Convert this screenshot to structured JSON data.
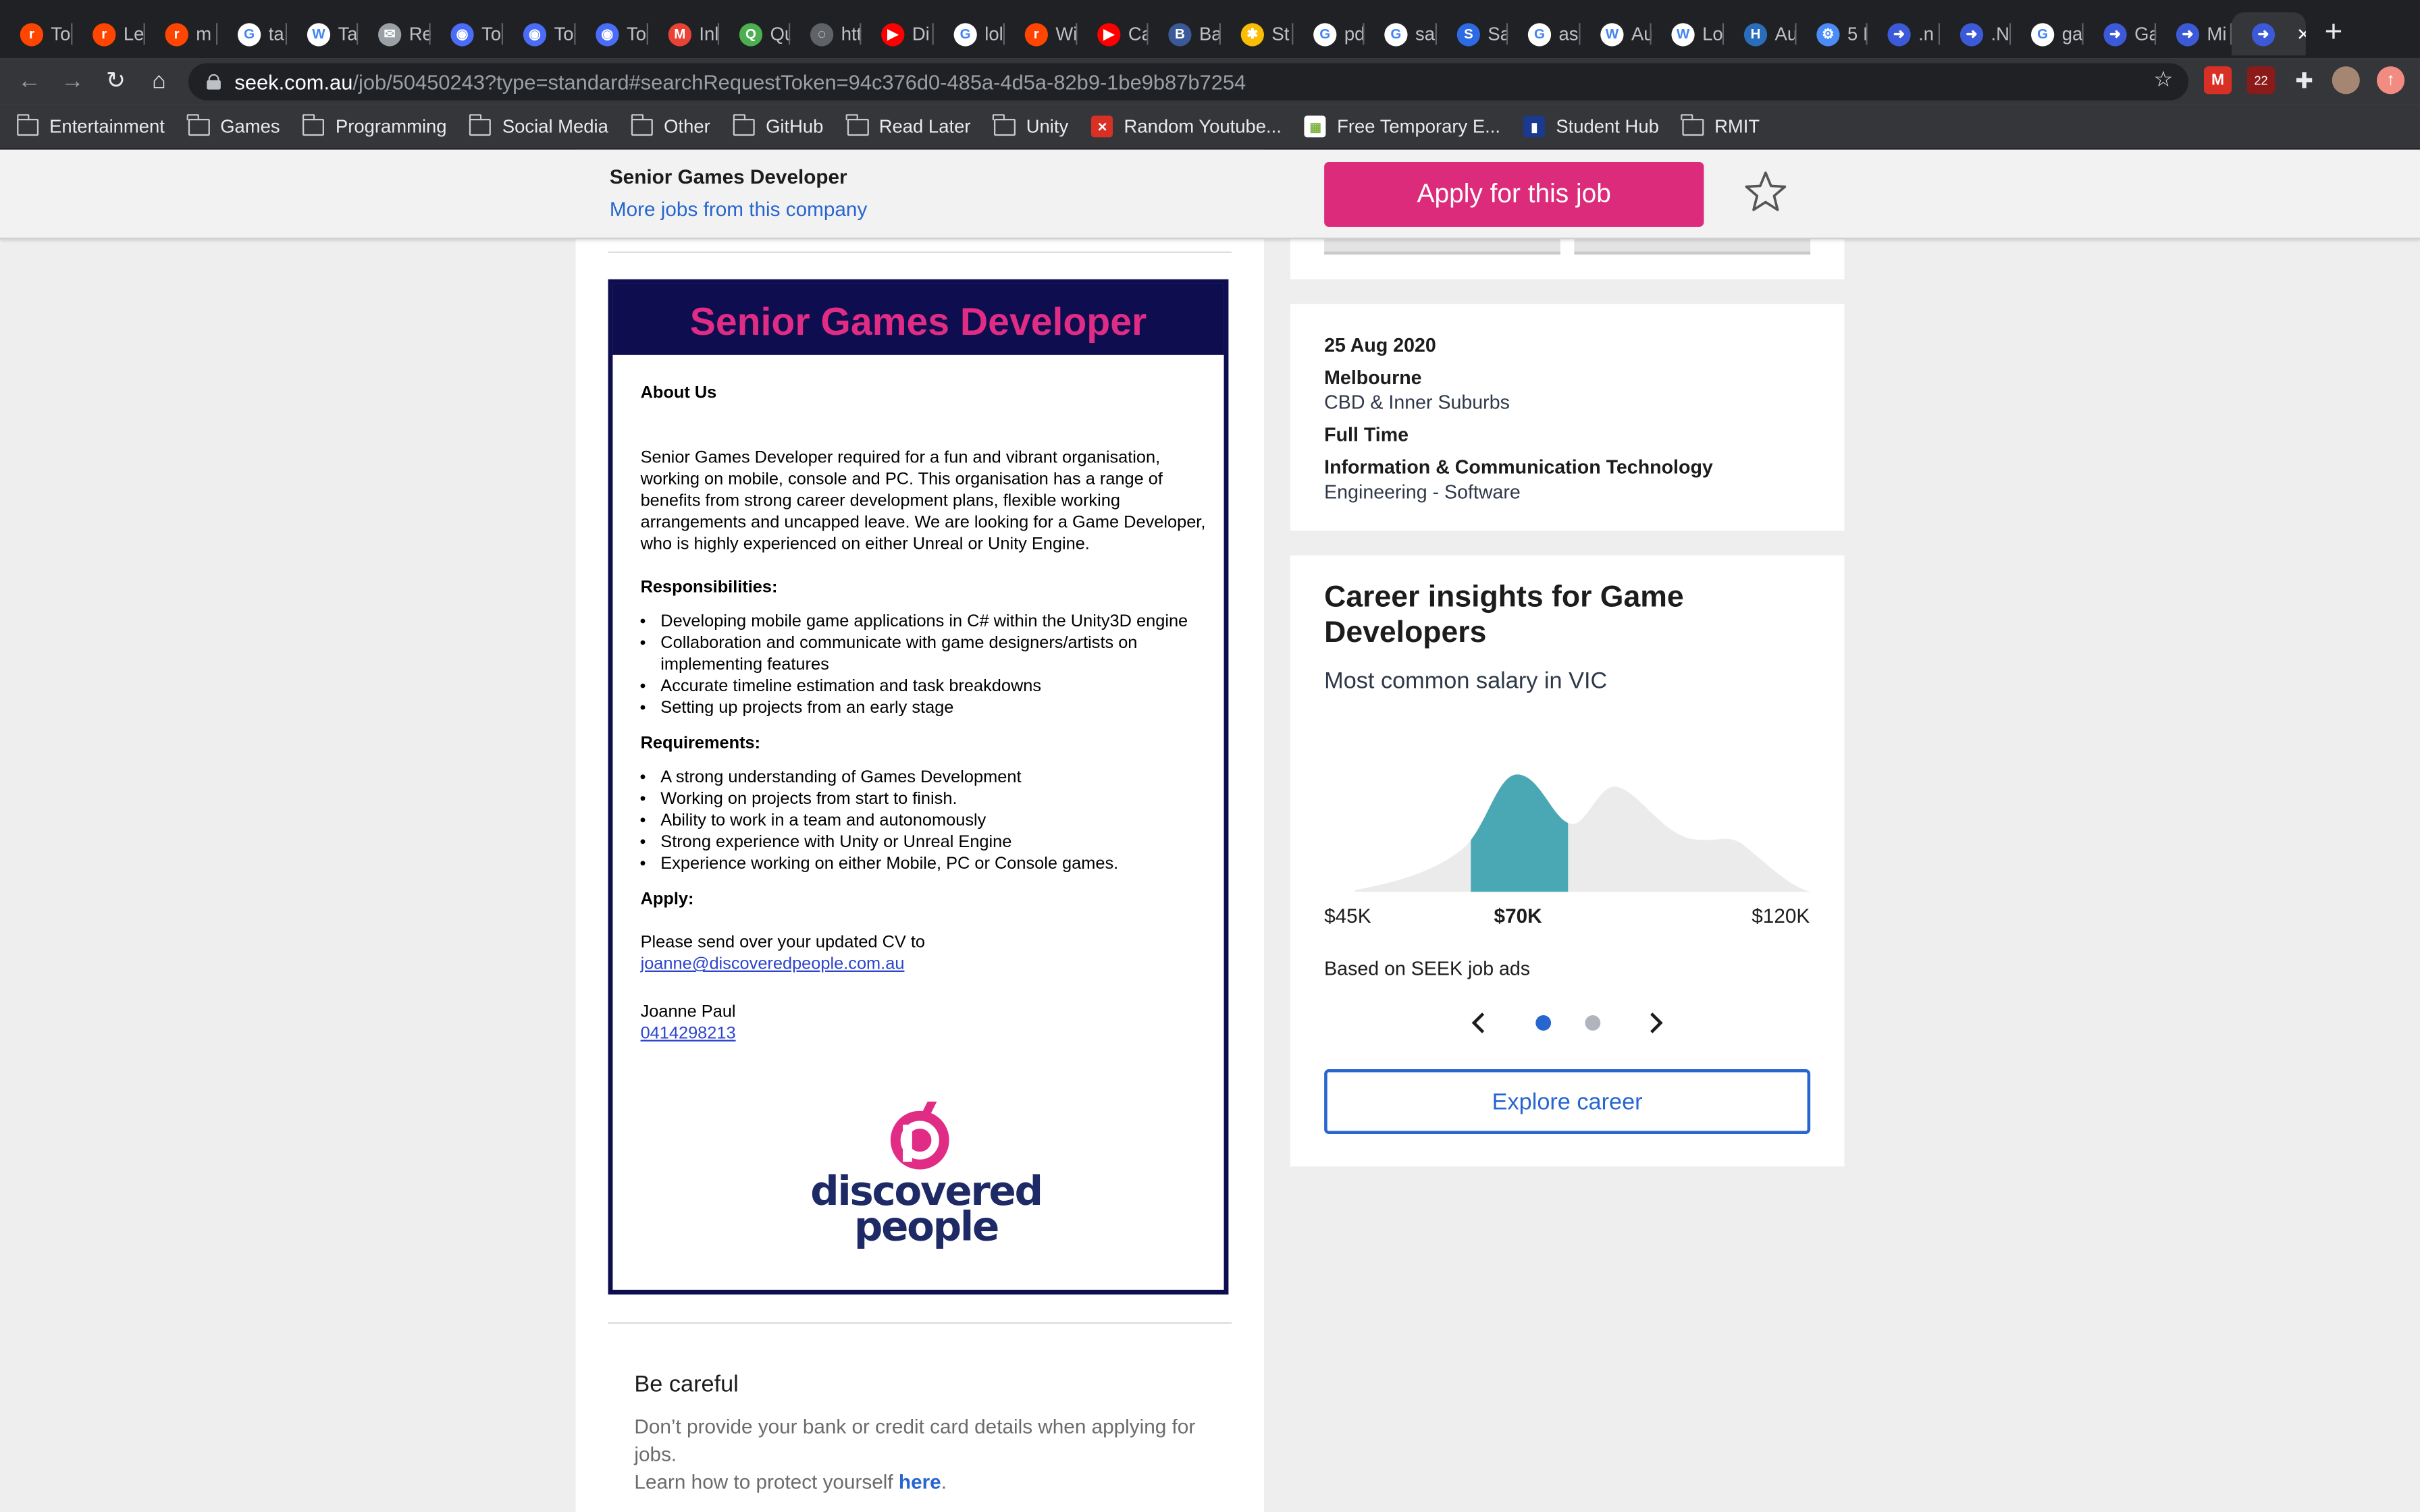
{
  "browser": {
    "tabs": [
      {
        "label": "To",
        "color": "#ff4500",
        "glyph": "r"
      },
      {
        "label": "Le",
        "color": "#ff4500",
        "glyph": "r"
      },
      {
        "label": "m",
        "color": "#ff4500",
        "glyph": "r"
      },
      {
        "label": "ta",
        "color": "#ffffff",
        "glyph": "G"
      },
      {
        "label": "Ta",
        "color": "#ffffff",
        "glyph": "W"
      },
      {
        "label": "Re",
        "color": "#9aa0a6",
        "glyph": "✉"
      },
      {
        "label": "To",
        "color": "#4a6cf7",
        "glyph": "◉"
      },
      {
        "label": "To",
        "color": "#4a6cf7",
        "glyph": "◉"
      },
      {
        "label": "To",
        "color": "#4a6cf7",
        "glyph": "◉"
      },
      {
        "label": "Inl",
        "color": "#ea4335",
        "glyph": "M"
      },
      {
        "label": "Qu",
        "color": "#4caf50",
        "glyph": "Q"
      },
      {
        "label": "htt",
        "color": "#5f6368",
        "glyph": "◌"
      },
      {
        "label": "Di",
        "color": "#ff0000",
        "glyph": "▶"
      },
      {
        "label": "lol",
        "color": "#ffffff",
        "glyph": "G"
      },
      {
        "label": "Wi",
        "color": "#ff4500",
        "glyph": "r"
      },
      {
        "label": "Ca",
        "color": "#ff0000",
        "glyph": "▶"
      },
      {
        "label": "Ba",
        "color": "#3b5998",
        "glyph": "B"
      },
      {
        "label": "St",
        "color": "#fbbc04",
        "glyph": "✱"
      },
      {
        "label": "pd",
        "color": "#ffffff",
        "glyph": "G"
      },
      {
        "label": "sa",
        "color": "#ffffff",
        "glyph": "G"
      },
      {
        "label": "Sa",
        "color": "#2d6ae3",
        "glyph": "S"
      },
      {
        "label": "as",
        "color": "#ffffff",
        "glyph": "G"
      },
      {
        "label": "Au",
        "color": "#ffffff",
        "glyph": "W"
      },
      {
        "label": "Lo",
        "color": "#ffffff",
        "glyph": "W"
      },
      {
        "label": "Au",
        "color": "#2a6ebb",
        "glyph": "H"
      },
      {
        "label": "5 I",
        "color": "#4a8df6",
        "glyph": "⚙"
      },
      {
        "label": ".n",
        "color": "#3c5ad8",
        "glyph": "➜"
      },
      {
        "label": ".N",
        "color": "#3c5ad8",
        "glyph": "➜"
      },
      {
        "label": "ga",
        "color": "#ffffff",
        "glyph": "G"
      },
      {
        "label": "Ga",
        "color": "#3c5ad8",
        "glyph": "➜"
      },
      {
        "label": "Mi",
        "color": "#3c5ad8",
        "glyph": "➜"
      },
      {
        "label": "",
        "color": "#3c5ad8",
        "glyph": "➜",
        "active": true
      }
    ],
    "url_host": "seek.com.au",
    "url_rest": "/job/50450243?type=standard#searchRequestToken=94c376d0-485a-4d5a-82b9-1be9b87b7254",
    "extension_badge": "22",
    "bookmarks": [
      {
        "label": "Entertainment",
        "type": "folder"
      },
      {
        "label": "Games",
        "type": "folder"
      },
      {
        "label": "Programming",
        "type": "folder"
      },
      {
        "label": "Social Media",
        "type": "folder"
      },
      {
        "label": "Other",
        "type": "folder"
      },
      {
        "label": "GitHub",
        "type": "folder"
      },
      {
        "label": "Read Later",
        "type": "folder"
      },
      {
        "label": "Unity",
        "type": "folder"
      },
      {
        "label": "Random Youtube...",
        "type": "link",
        "color": "#d93025"
      },
      {
        "label": "Free Temporary E...",
        "type": "link",
        "color": "#ffffff"
      },
      {
        "label": "Student Hub",
        "type": "link",
        "color": "#1a3a8f"
      },
      {
        "label": "RMIT",
        "type": "folder"
      }
    ]
  },
  "header": {
    "job_title": "Senior Games Developer",
    "more_jobs": "More jobs from this company",
    "apply_label": "Apply for this job",
    "accent": "#db2b7a"
  },
  "ad": {
    "title": "Senior Games Developer",
    "about_heading": "About Us",
    "about_text": "Senior Games Developer required for a fun and vibrant organisation, working on mobile, console and PC. This  organisation has a range of benefits from strong career development plans, flexible working arrangements and uncapped leave. We are looking for a Game Developer, who is highly experienced on either Unreal or Unity Engine.",
    "responsibilities_heading": "Responsibilities:",
    "responsibilities": [
      "Developing mobile game applications in C# within the Unity3D engine",
      "Collaboration and communicate with game designers/artists on implementing features",
      "Accurate timeline estimation and task breakdowns",
      "Setting up projects from an early stage"
    ],
    "requirements_heading": "Requirements:",
    "requirements": [
      "A strong understanding of Games Development",
      "Working on projects from start to finish.",
      "Ability to work in a team and autonomously",
      "Strong experience with Unity or Unreal Engine",
      "Experience working on either Mobile, PC or Console games."
    ],
    "apply_heading": "Apply:",
    "apply_text": "Please send over your updated CV to",
    "email": "joanne@discoveredpeople.com.au",
    "contact_name": "Joanne Paul",
    "phone": "0414298213",
    "logo_line1": "discovered",
    "logo_line2": "people"
  },
  "careful": {
    "heading": "Be careful",
    "text": "Don’t provide your bank or credit card details when applying for jobs.",
    "learn_prefix": "Learn how to protect yourself",
    "learn_link": "here",
    "learn_suffix": "."
  },
  "details": {
    "date": "25 Aug 2020",
    "location": "Melbourne",
    "area": "CBD & Inner Suburbs",
    "work_type": "Full Time",
    "classification": "Information & Communication Technology",
    "sub_classification": "Engineering - Software"
  },
  "insights": {
    "title": "Career insights for Game Developers",
    "subtitle": "Most common salary in VIC",
    "based_on": "Based on SEEK job ads",
    "explore_label": "Explore career",
    "active_dot": 0,
    "dot_count": 2,
    "highlight_color": "#4aa8b4"
  },
  "chart_data": {
    "type": "area",
    "min_label": "$45K",
    "common_label": "$70K",
    "max_label": "$120K"
  }
}
